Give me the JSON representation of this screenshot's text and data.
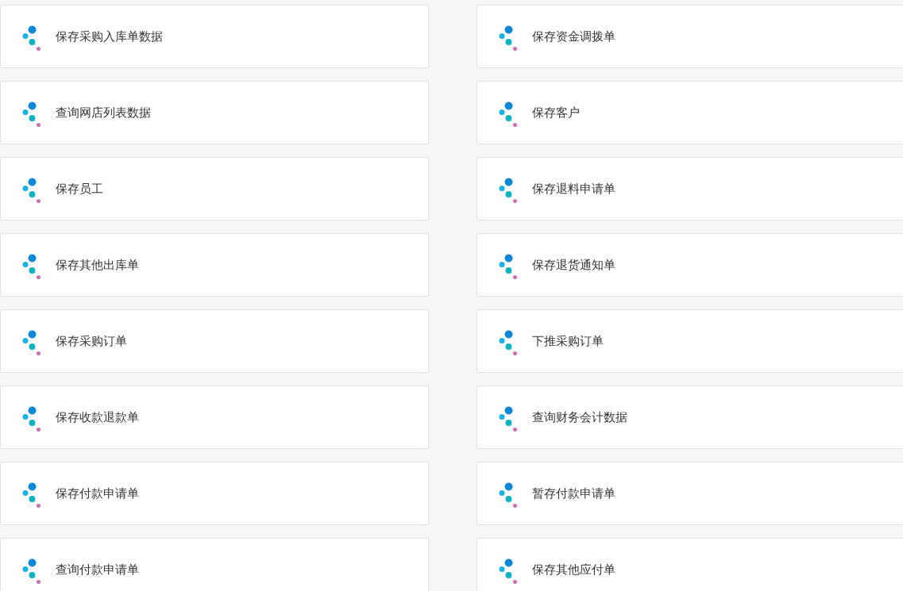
{
  "items": [
    {
      "label": "保存采购入库单数据"
    },
    {
      "label": "保存资金调拨单"
    },
    {
      "label": "查询网店列表数据"
    },
    {
      "label": "保存客户"
    },
    {
      "label": "保存员工"
    },
    {
      "label": "保存退料申请单"
    },
    {
      "label": "保存其他出库单"
    },
    {
      "label": "保存退货通知单"
    },
    {
      "label": "保存采购订单"
    },
    {
      "label": "下推采购订单"
    },
    {
      "label": "保存收款退款单"
    },
    {
      "label": "查询财务会计数据"
    },
    {
      "label": "保存付款申请单"
    },
    {
      "label": "暂存付款申请单"
    },
    {
      "label": "查询付款申请单"
    },
    {
      "label": "保存其他应付单"
    }
  ]
}
